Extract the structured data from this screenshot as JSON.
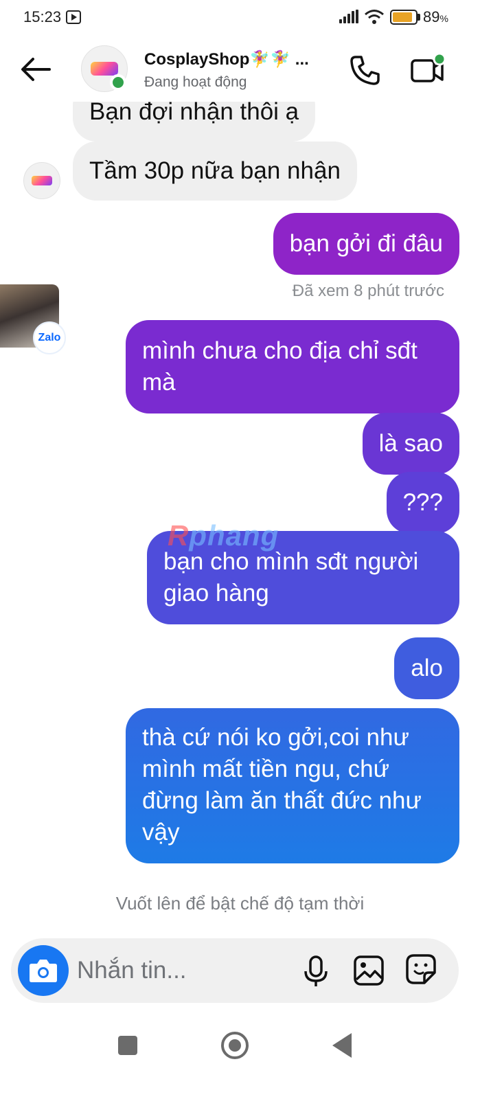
{
  "status_bar": {
    "time": "15:23",
    "battery_percent": "89",
    "battery_unit": "%",
    "battery_level": 0.89,
    "icons": [
      "media-app-icon",
      "signal-icon",
      "wifi-icon",
      "battery-icon"
    ]
  },
  "header": {
    "contact_name": "CosplayShop🧚‍♀️🧚‍♀️ ...",
    "presence": "Đang hoạt động",
    "presence_color": "#31a24c",
    "icons": [
      "back-arrow-icon",
      "phone-icon",
      "video-camera-icon"
    ]
  },
  "messages": [
    {
      "side": "incoming",
      "text": "Bạn đợi nhận thôi ạ"
    },
    {
      "side": "incoming",
      "text": "Tầm 30p nữa bạn nhận"
    },
    {
      "side": "outgoing",
      "text": "bạn gởi đi đâu"
    },
    {
      "side": "outgoing",
      "text": "mình chưa cho địa chỉ sđt mà"
    },
    {
      "side": "outgoing",
      "text": "là sao"
    },
    {
      "side": "outgoing",
      "text": "???"
    },
    {
      "side": "outgoing",
      "text": "bạn cho mình sđt người giao hàng"
    },
    {
      "side": "outgoing",
      "text": "alo"
    },
    {
      "side": "outgoing",
      "text": "thà cứ nói ko gởi,coi như mình mất tiền ngu, chứ đừng làm ăn thất đức như vậy"
    }
  ],
  "seen_receipt": "Đã xem 8 phút trước",
  "zalo_bubble": {
    "label": "Zalo"
  },
  "watermark": {
    "part1": "R",
    "part2": "phang"
  },
  "vanish_hint": "Vuốt lên để bật chế độ tạm thời",
  "composer": {
    "placeholder": "Nhắn tin...",
    "icons": [
      "camera-icon",
      "microphone-icon",
      "gallery-icon",
      "sticker-icon"
    ]
  },
  "colors": {
    "accent_blue": "#1877f2",
    "incoming_bubble": "#efefef",
    "outgoing_gradient_top": "#8e24c8",
    "outgoing_gradient_bottom": "#1e7be6"
  },
  "navbar": {
    "icons": [
      "recents-square-icon",
      "home-circle-icon",
      "back-triangle-icon"
    ]
  }
}
